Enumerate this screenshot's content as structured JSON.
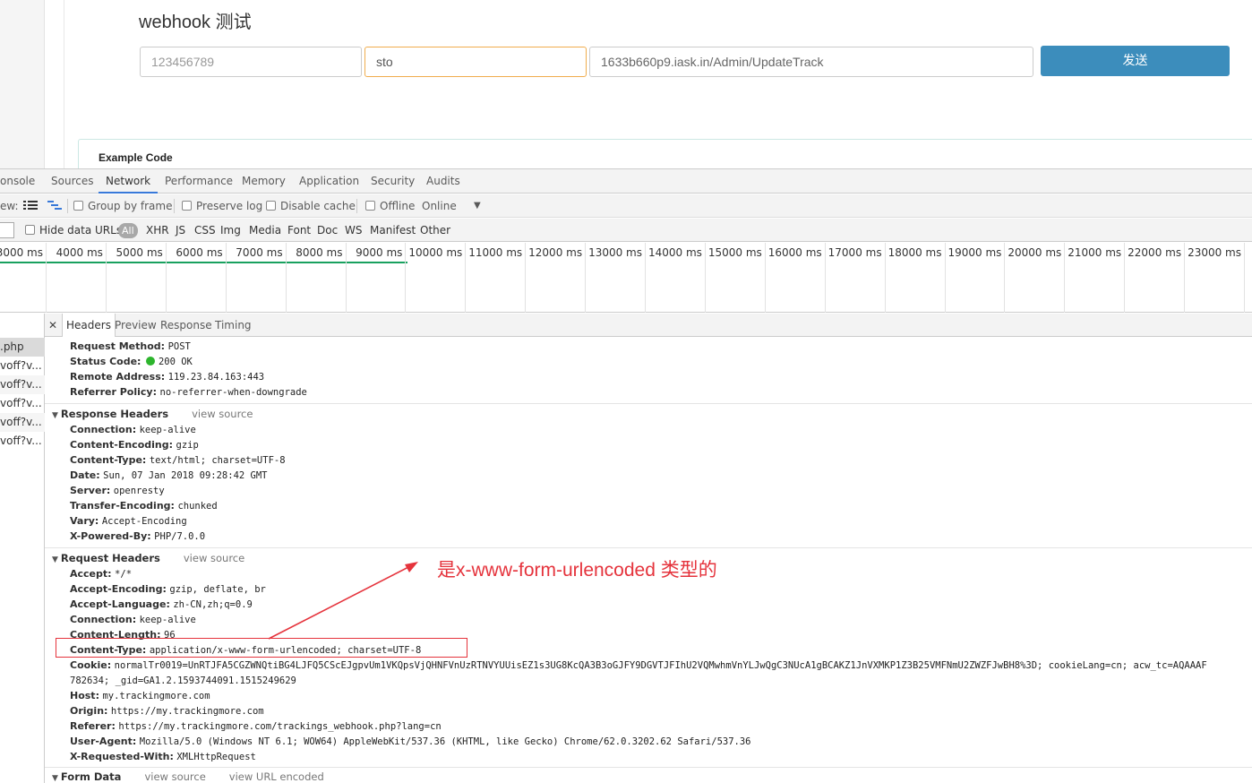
{
  "page": {
    "title": "webhook 测试",
    "id_value": "123456789",
    "carrier_value": "sto",
    "url_value": "1633b660p9.iask.in/Admin/UpdateTrack",
    "send_label": "发送",
    "example_title": "Example Code"
  },
  "devtools": {
    "tabs": [
      "onsole",
      "Sources",
      "Network",
      "Performance",
      "Memory",
      "Application",
      "Security",
      "Audits"
    ],
    "active_tab": "Network",
    "toolbar": {
      "view_label": "ew:",
      "group_by_frame": "Group by frame",
      "preserve_log": "Preserve log",
      "disable_cache": "Disable cache",
      "offline": "Offline",
      "online": "Online"
    },
    "filter": {
      "hide_data_urls": "Hide data URLs",
      "types": [
        "All",
        "XHR",
        "JS",
        "CSS",
        "Img",
        "Media",
        "Font",
        "Doc",
        "WS",
        "Manifest",
        "Other"
      ]
    },
    "timeline": [
      "3000 ms",
      "4000 ms",
      "5000 ms",
      "6000 ms",
      "7000 ms",
      "8000 ms",
      "9000 ms",
      "10000 ms",
      "11000 ms",
      "12000 ms",
      "13000 ms",
      "14000 ms",
      "15000 ms",
      "16000 ms",
      "17000 ms",
      "18000 ms",
      "19000 ms",
      "20000 ms",
      "21000 ms",
      "22000 ms",
      "23000 ms"
    ],
    "requests": [
      ".php",
      "voff?v...",
      "voff?v...",
      "voff?v...",
      "voff?v...",
      "voff?v..."
    ],
    "panel_tabs": [
      "Headers",
      "Preview",
      "Response",
      "Timing"
    ],
    "general": [
      {
        "k": "Request Method:",
        "v": "POST"
      },
      {
        "k": "Status Code:",
        "v": "200 OK"
      },
      {
        "k": "Remote Address:",
        "v": "119.23.84.163:443"
      },
      {
        "k": "Referrer Policy:",
        "v": "no-referrer-when-downgrade"
      }
    ],
    "response_headers": {
      "title": "Response Headers",
      "view_source": "view source",
      "items": [
        {
          "k": "Connection:",
          "v": "keep-alive"
        },
        {
          "k": "Content-Encoding:",
          "v": "gzip"
        },
        {
          "k": "Content-Type:",
          "v": "text/html; charset=UTF-8"
        },
        {
          "k": "Date:",
          "v": "Sun, 07 Jan 2018 09:28:42 GMT"
        },
        {
          "k": "Server:",
          "v": "openresty"
        },
        {
          "k": "Transfer-Encoding:",
          "v": "chunked"
        },
        {
          "k": "Vary:",
          "v": "Accept-Encoding"
        },
        {
          "k": "X-Powered-By:",
          "v": "PHP/7.0.0"
        }
      ]
    },
    "request_headers": {
      "title": "Request Headers",
      "view_source": "view source",
      "items": [
        {
          "k": "Accept:",
          "v": "*/*"
        },
        {
          "k": "Accept-Encoding:",
          "v": "gzip, deflate, br"
        },
        {
          "k": "Accept-Language:",
          "v": "zh-CN,zh;q=0.9"
        },
        {
          "k": "Connection:",
          "v": "keep-alive"
        },
        {
          "k": "Content-Length:",
          "v": "96"
        },
        {
          "k": "Content-Type:",
          "v": "application/x-www-form-urlencoded; charset=UTF-8"
        },
        {
          "k": "Cookie:",
          "v": "normalTr0019=UnRTJFA5CGZWNQtiBG4LJFQ5CScEJgpvUm1VKQpsVjQHNFVnUzRTNVYUUisEZ1s3UG8KcQA3B3oGJFY9DGVTJFIhU2VQMwhmVnYLJwQgC3NUcA1gBCAKZ1JnVXMKP1Z3B25VMFNmU2ZWZFJwBH8%3D; cookieLang=cn; acw_tc=AQAAAF"
        },
        {
          "k": "",
          "v": "782634; _gid=GA1.2.1593744091.1515249629"
        },
        {
          "k": "Host:",
          "v": "my.trackingmore.com"
        },
        {
          "k": "Origin:",
          "v": "https://my.trackingmore.com"
        },
        {
          "k": "Referer:",
          "v": "https://my.trackingmore.com/trackings_webhook.php?lang=cn"
        },
        {
          "k": "User-Agent:",
          "v": "Mozilla/5.0 (Windows NT 6.1; WOW64) AppleWebKit/537.36 (KHTML, like Gecko) Chrome/62.0.3202.62 Safari/537.36"
        },
        {
          "k": "X-Requested-With:",
          "v": "XMLHttpRequest"
        }
      ]
    },
    "form_data": {
      "title": "Form Data",
      "view_source": "view source",
      "view_url_encoded": "view URL encoded"
    }
  },
  "annotation": {
    "text": "是x-www-form-urlencoded 类型的",
    "color": "#e5333c"
  }
}
